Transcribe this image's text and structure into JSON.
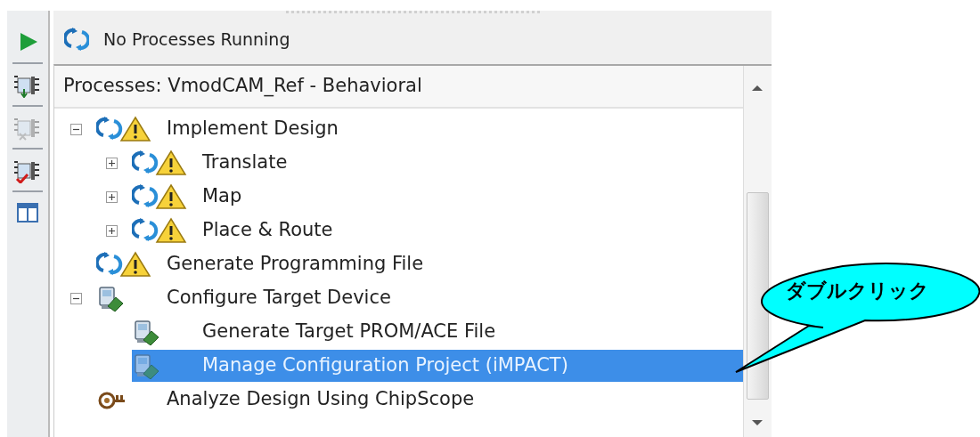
{
  "toolbar": [
    {
      "kind": "run",
      "disabled": false
    },
    {
      "kind": "chip-arrow",
      "disabled": false
    },
    {
      "kind": "chip-x",
      "disabled": true
    },
    {
      "kind": "chip-check",
      "disabled": false
    },
    {
      "kind": "panel",
      "disabled": false
    }
  ],
  "status": {
    "text": "No Processes Running"
  },
  "panel_title": "Processes: VmodCAM_Ref - Behavioral",
  "tree": [
    {
      "label": "Implement Design",
      "kind": "process",
      "selected": false,
      "expanded": true,
      "children": [
        {
          "label": "Translate",
          "kind": "process",
          "selected": false,
          "expanded": false
        },
        {
          "label": "Map",
          "kind": "process",
          "selected": false,
          "expanded": false
        },
        {
          "label": "Place & Route",
          "kind": "process",
          "selected": false,
          "expanded": false
        }
      ]
    },
    {
      "label": "Generate Programming File",
      "kind": "process",
      "selected": false
    },
    {
      "label": "Configure Target Device",
      "kind": "config",
      "selected": false,
      "expanded": true,
      "children": [
        {
          "label": "Generate Target PROM/ACE File",
          "kind": "config",
          "selected": false
        },
        {
          "label": "Manage Configuration Project (iMPACT)",
          "kind": "config",
          "selected": true
        }
      ]
    },
    {
      "label": "Analyze Design Using ChipScope",
      "kind": "chipscope",
      "selected": false
    }
  ],
  "callout": {
    "text": "ダブルクリック"
  }
}
